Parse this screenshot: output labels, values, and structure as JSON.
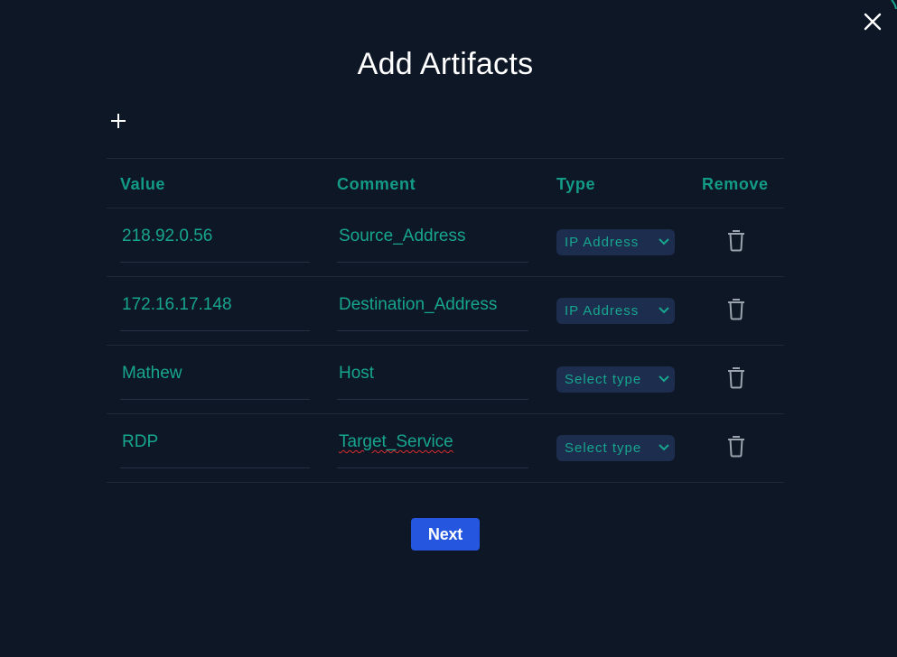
{
  "dialog": {
    "title": "Add Artifacts",
    "next_label": "Next"
  },
  "table": {
    "headers": [
      "Value",
      "Comment",
      "Type",
      "Remove"
    ],
    "rows": [
      {
        "value": "218.92.0.56",
        "comment": "Source_Address",
        "type": "IP Address"
      },
      {
        "value": "172.16.17.148",
        "comment": "Destination_Address",
        "type": "IP Address"
      },
      {
        "value": "Mathew",
        "comment": "Host",
        "type": "Select type"
      },
      {
        "value": "RDP",
        "comment": "Target_Service",
        "type": "Select type"
      }
    ]
  },
  "icons": {
    "close": "close-icon",
    "add": "plus-icon",
    "select_arrow": "chevron-down-icon",
    "remove": "trash-icon"
  },
  "colors": {
    "background": "#0e1726",
    "accent_teal": "#17a58e",
    "select_bg": "#1c2d4d",
    "primary_button": "#2456e0"
  }
}
